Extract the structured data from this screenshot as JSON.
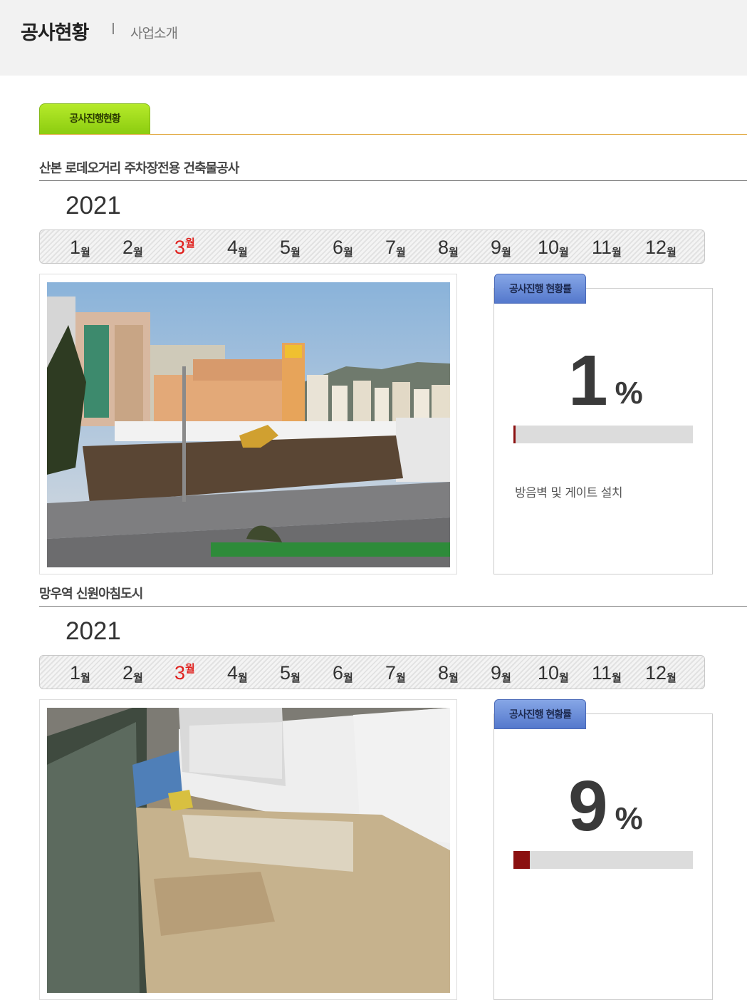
{
  "header": {
    "title": "공사현황",
    "breadcrumb": "사업소개"
  },
  "tab": {
    "label": "공사진행현황"
  },
  "projects": [
    {
      "name": "산본 로데오거리 주차장전용 건축물공사",
      "year": "2021",
      "months": [
        "1",
        "2",
        "3",
        "4",
        "5",
        "6",
        "7",
        "8",
        "9",
        "10",
        "11",
        "12"
      ],
      "month_unit": "월",
      "active_month": "3",
      "photo_icon": "construction-site-photo",
      "rate_label": "공사진행 현황률",
      "progress_value": "1",
      "progress_symbol": "%",
      "progress_fraction": 0.01,
      "description": "방음벽 및 게이트 설치"
    },
    {
      "name": "망우역 신원아침도시",
      "year": "2021",
      "months": [
        "1",
        "2",
        "3",
        "4",
        "5",
        "6",
        "7",
        "8",
        "9",
        "10",
        "11",
        "12"
      ],
      "month_unit": "월",
      "active_month": "3",
      "photo_icon": "apartment-construction-photo",
      "rate_label": "공사진행 현황률",
      "progress_value": "9",
      "progress_symbol": "%",
      "progress_fraction": 0.09,
      "description": ""
    }
  ],
  "colors": {
    "active_month": "#e0201d",
    "progress_fill": "#8b1010",
    "tab_green": "#9bd81a",
    "rate_tab_blue": "#6a8ed8"
  }
}
